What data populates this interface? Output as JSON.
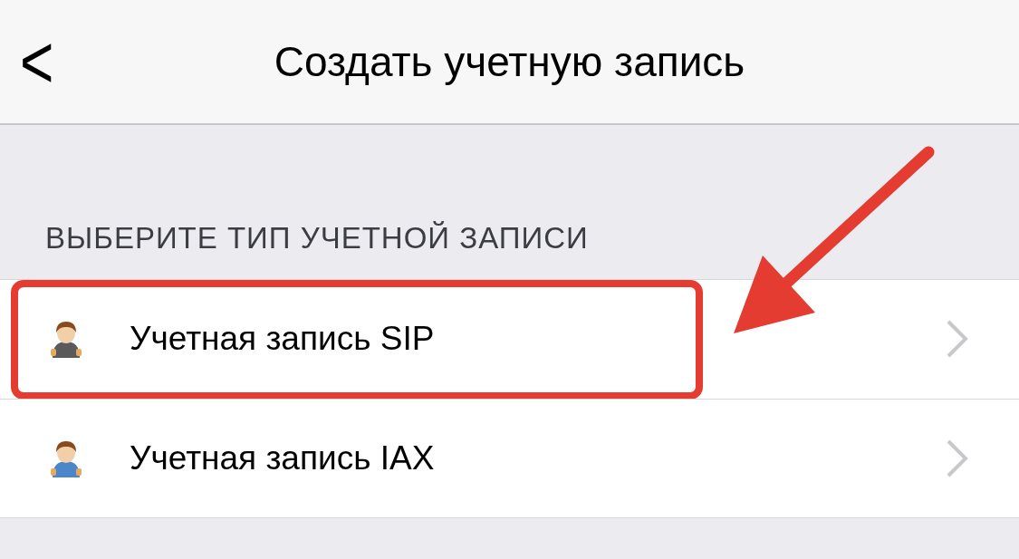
{
  "nav_bar": {
    "back": "<",
    "title": "Создать учетную запись"
  },
  "section": {
    "header": "ВЫБЕРИТЕ ТИП УЧЕТНОЙ ЗАПИСИ",
    "items": [
      {
        "label": "Учетная запись SIP",
        "color": "#5a5a5a",
        "highlighted": true
      },
      {
        "label": "Учетная запись IAX",
        "color": "#4a86c8",
        "highlighted": false
      }
    ]
  }
}
